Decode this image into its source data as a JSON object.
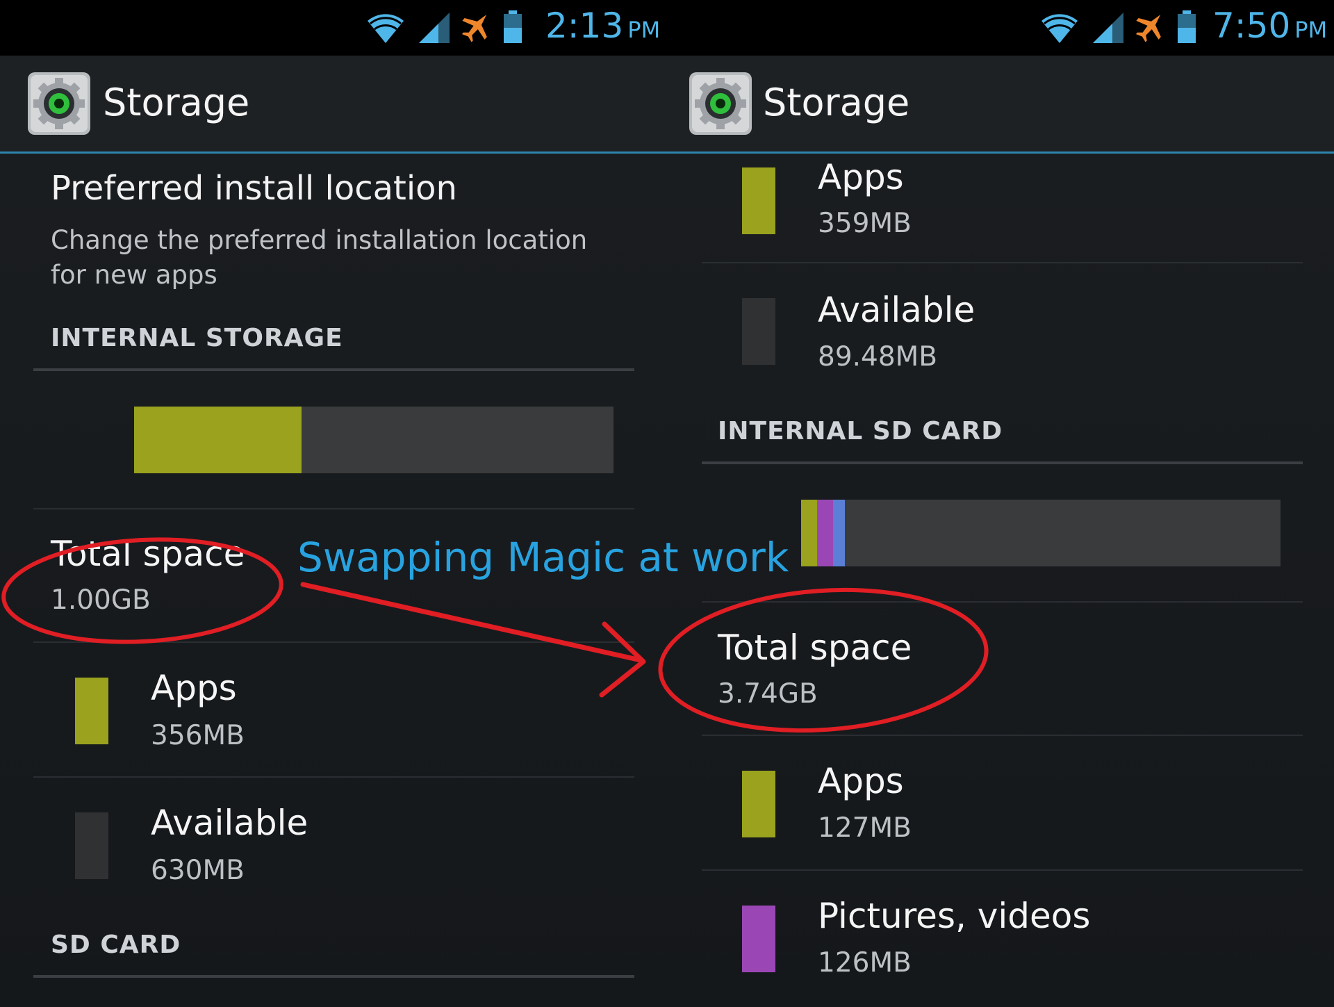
{
  "caption": "Swapping Magic at work",
  "colors": {
    "apps": "#9aa21e",
    "available": "#3a3b3c",
    "pictures": "#9a47b5",
    "blue_segment": "#5b7fd6",
    "annotation": "#e01e24",
    "caption": "#28a3e0",
    "status": "#4fb6ea"
  },
  "icons": [
    "wifi-icon",
    "signal-icon",
    "airplane-icon",
    "battery-icon",
    "settings-gear-icon"
  ],
  "left": {
    "status": {
      "time": "2:13",
      "ampm": "PM"
    },
    "title": "Storage",
    "preferred": {
      "title": "Preferred install location",
      "summary": "Change the preferred installation location for new apps"
    },
    "internal_storage": {
      "header": "INTERNAL STORAGE",
      "usage_fraction_apps": 0.35,
      "total": {
        "label": "Total space",
        "value": "1.00GB"
      },
      "apps": {
        "label": "Apps",
        "value": "356MB"
      },
      "available": {
        "label": "Available",
        "value": "630MB"
      }
    },
    "sd_card": {
      "header": "SD CARD"
    }
  },
  "right": {
    "status": {
      "time": "7:50",
      "ampm": "PM"
    },
    "title": "Storage",
    "top_rows": {
      "apps": {
        "label": "Apps",
        "value": "359MB"
      },
      "available": {
        "label": "Available",
        "value": "89.48MB"
      }
    },
    "internal_sd": {
      "header": "INTERNAL SD CARD",
      "usage_fractions": {
        "apps": 0.034,
        "pictures": 0.034,
        "other": 0.025
      },
      "total": {
        "label": "Total space",
        "value": "3.74GB"
      },
      "apps": {
        "label": "Apps",
        "value": "127MB"
      },
      "pictures": {
        "label": "Pictures, videos",
        "value": "126MB"
      }
    }
  }
}
